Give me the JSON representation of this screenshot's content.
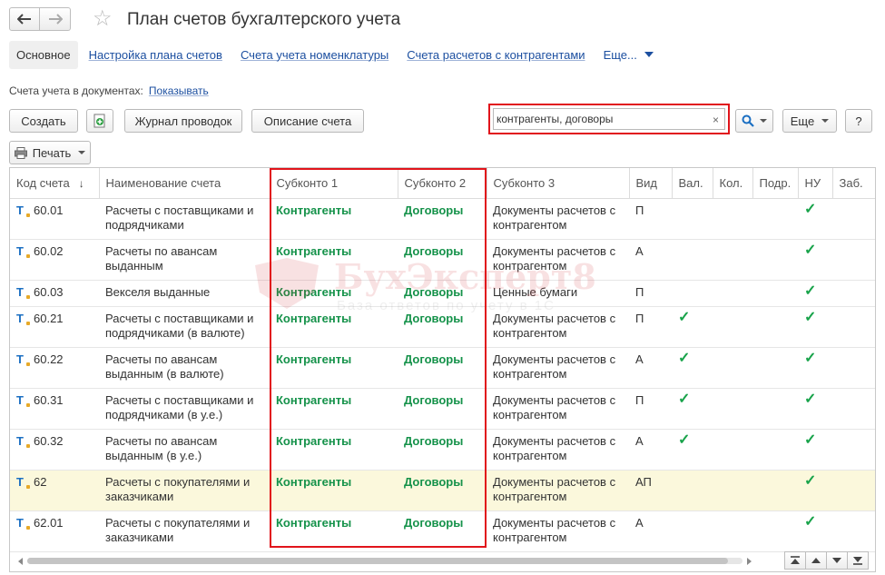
{
  "window": {
    "title": "План счетов бухгалтерского учета"
  },
  "tabs": {
    "active": "Основное",
    "links": [
      "Настройка плана счетов",
      "Счета учета номенклатуры",
      "Счета расчетов с контрагентами"
    ],
    "more": "Еще..."
  },
  "doc_accounts": {
    "label": "Счета учета в документах:",
    "link": "Показывать"
  },
  "toolbar": {
    "create": "Создать",
    "journal": "Журнал проводок",
    "description": "Описание счета",
    "more": "Еще",
    "help": "?",
    "print": "Печать"
  },
  "search": {
    "value": "контрагенты, договоры",
    "clear": "×"
  },
  "table": {
    "columns": [
      "Код счета",
      "Наименование счета",
      "Субконто 1",
      "Субконто 2",
      "Субконто 3",
      "Вид",
      "Вал.",
      "Кол.",
      "Подр.",
      "НУ",
      "Заб."
    ],
    "sort_indicator": "↓",
    "rows": [
      {
        "code": "60.01",
        "name": "Расчеты с поставщиками и подрядчиками",
        "s1": "Контрагенты",
        "s2": "Договоры",
        "s3": "Документы расчетов с контрагентом",
        "vid": "П",
        "val": "",
        "nu": "✓",
        "highlight": false
      },
      {
        "code": "60.02",
        "name": "Расчеты по авансам выданным",
        "s1": "Контрагенты",
        "s2": "Договоры",
        "s3": "Документы расчетов с контрагентом",
        "vid": "А",
        "val": "",
        "nu": "✓",
        "highlight": false
      },
      {
        "code": "60.03",
        "name": "Векселя выданные",
        "s1": "Контрагенты",
        "s2": "Договоры",
        "s3": "Ценные бумаги",
        "vid": "П",
        "val": "",
        "nu": "✓",
        "highlight": false
      },
      {
        "code": "60.21",
        "name": "Расчеты с поставщиками и подрядчиками (в валюте)",
        "s1": "Контрагенты",
        "s2": "Договоры",
        "s3": "Документы расчетов с контрагентом",
        "vid": "П",
        "val": "✓",
        "nu": "✓",
        "highlight": false
      },
      {
        "code": "60.22",
        "name": "Расчеты по авансам выданным (в валюте)",
        "s1": "Контрагенты",
        "s2": "Договоры",
        "s3": "Документы расчетов с контрагентом",
        "vid": "А",
        "val": "✓",
        "nu": "✓",
        "highlight": false
      },
      {
        "code": "60.31",
        "name": "Расчеты с поставщиками и подрядчиками (в у.е.)",
        "s1": "Контрагенты",
        "s2": "Договоры",
        "s3": "Документы расчетов с контрагентом",
        "vid": "П",
        "val": "✓",
        "nu": "✓",
        "highlight": false
      },
      {
        "code": "60.32",
        "name": "Расчеты по авансам выданным (в у.е.)",
        "s1": "Контрагенты",
        "s2": "Договоры",
        "s3": "Документы расчетов с контрагентом",
        "vid": "А",
        "val": "✓",
        "nu": "✓",
        "highlight": false
      },
      {
        "code": "62",
        "name": "Расчеты с покупателями и заказчиками",
        "s1": "Контрагенты",
        "s2": "Договоры",
        "s3": "Документы расчетов с контрагентом",
        "vid": "АП",
        "val": "",
        "nu": "✓",
        "highlight": true
      },
      {
        "code": "62.01",
        "name": "Расчеты с покупателями и заказчиками",
        "s1": "Контрагенты",
        "s2": "Договоры",
        "s3": "Документы расчетов с контрагентом",
        "vid": "А",
        "val": "",
        "nu": "✓",
        "highlight": false
      }
    ]
  },
  "watermark": {
    "title": "БухЭксперт8",
    "subtitle": "База ответов по учету в 1С"
  },
  "colors": {
    "accent_red": "#e1141b",
    "link_blue": "#1c4fa0",
    "green": "#15924a",
    "highlight_row": "#fbf8dc"
  }
}
